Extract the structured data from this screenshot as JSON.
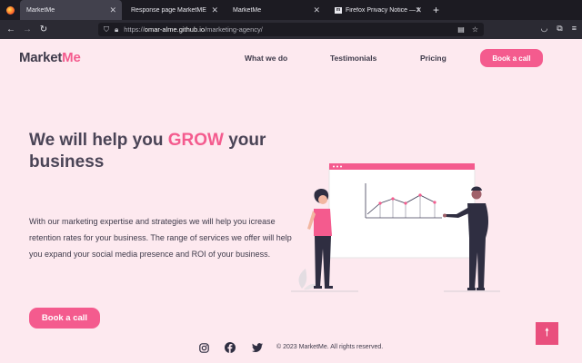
{
  "browser": {
    "tabs": [
      {
        "label": "MarketMe",
        "active": true
      },
      {
        "label": "Response page MarketME",
        "active": false
      },
      {
        "label": "MarketMe",
        "active": false
      },
      {
        "label": "Firefox Privacy Notice — Mozilla",
        "active": false
      }
    ],
    "url_prefix": "https://",
    "url_domain": "omar-alme.github.io",
    "url_path": "/marketing-agency/"
  },
  "header": {
    "logo_market": "Market",
    "logo_me": "Me",
    "nav": [
      "What we do",
      "Testimonials",
      "Pricing"
    ],
    "cta": "Book a call"
  },
  "hero": {
    "headline_pre": "We will help you ",
    "headline_highlight": "GROW",
    "headline_post": " your business",
    "body": "With our marketing expertise and strategies we will help you icrease retention rates for your business. The range of services we offer will help you expand your social media presence and ROI of your business.",
    "cta": "Book a call"
  },
  "footer": {
    "copyright": "© 2023 MarketMe. All rights reserved.",
    "social_icons": [
      "instagram-icon",
      "facebook-icon",
      "twitter-icon"
    ]
  },
  "colors": {
    "accent": "#f45b8e",
    "background": "#fde9ef",
    "text": "#3e3a4a"
  }
}
